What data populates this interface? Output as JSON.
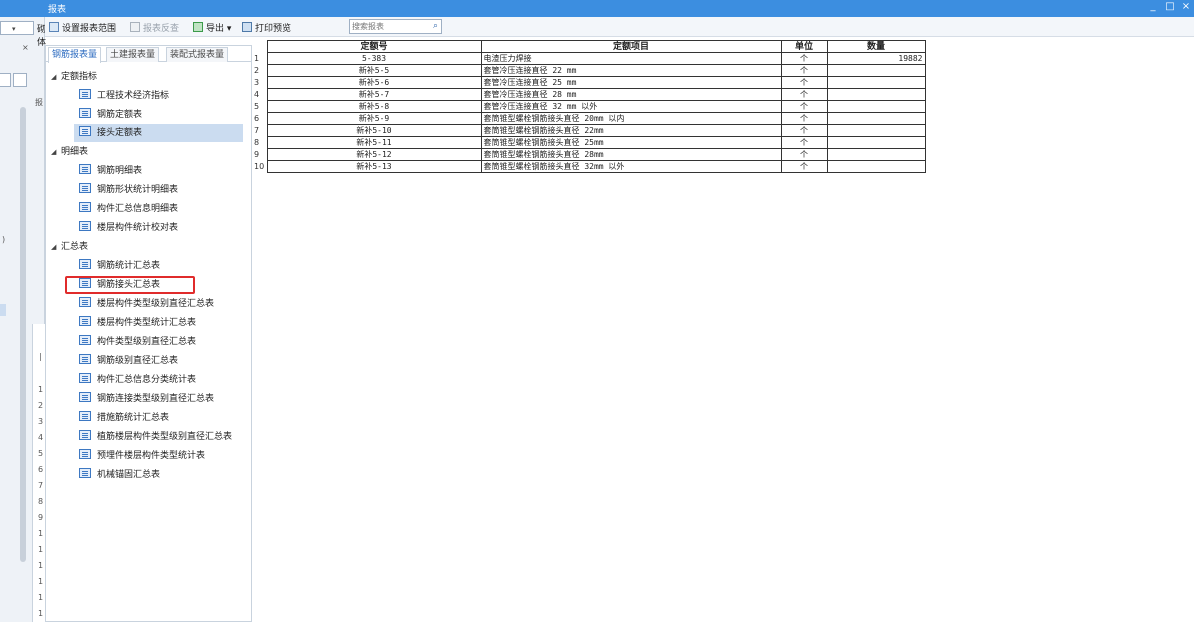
{
  "window": {
    "title": "报表",
    "controls": [
      "_",
      "□",
      "×"
    ]
  },
  "left_strip": {
    "combo_value": "",
    "combo_label": "砌体",
    "close_glyph": "×",
    "small_labels": [
      "报",
      ")",
      "|"
    ],
    "row_numbers": [
      "1",
      "2",
      "3",
      "4",
      "5",
      "6",
      "7",
      "8",
      "9",
      "1",
      "1",
      "1",
      "1",
      "1",
      "1",
      "1"
    ]
  },
  "toolbar": {
    "set_range": "设置报表范围",
    "report_query": "报表反查",
    "export": "导出",
    "export_caret": "▾",
    "print_preview": "打印预览",
    "search_placeholder": "搜索报表",
    "search_icon": "🔍"
  },
  "tree": {
    "tabs": [
      "钢筋报表量",
      "土建报表量",
      "装配式报表量"
    ],
    "active_tab": 0,
    "groups": [
      {
        "label": "定额指标",
        "items": [
          "工程技术经济指标",
          "钢筋定额表",
          "接头定额表"
        ]
      },
      {
        "label": "明细表",
        "items": [
          "钢筋明细表",
          "钢筋形状统计明细表",
          "构件汇总信息明细表",
          "楼层构件统计校对表"
        ]
      },
      {
        "label": "汇总表",
        "items": [
          "钢筋统计汇总表",
          "钢筋接头汇总表",
          "楼层构件类型级别直径汇总表",
          "楼层构件类型统计汇总表",
          "构件类型级别直径汇总表",
          "钢筋级别直径汇总表",
          "构件汇总信息分类统计表",
          "钢筋连接类型级别直径汇总表",
          "措施筋统计汇总表",
          "植筋楼层构件类型级别直径汇总表",
          "预埋件楼层构件类型统计表",
          "机械锚固汇总表"
        ]
      }
    ],
    "selected_item": "接头定额表",
    "highlighted_item": "钢筋接头汇总表"
  },
  "report": {
    "columns": [
      "定额号",
      "定额项目",
      "单位",
      "数量"
    ],
    "rows": [
      {
        "no": "1",
        "code": "5-383",
        "item": "电渣压力焊接",
        "unit": "个",
        "qty": "19882"
      },
      {
        "no": "2",
        "code": "新补5-5",
        "item": "套管冷压连接直径 22 mm",
        "unit": "个",
        "qty": ""
      },
      {
        "no": "3",
        "code": "新补5-6",
        "item": "套管冷压连接直径 25 mm",
        "unit": "个",
        "qty": ""
      },
      {
        "no": "4",
        "code": "新补5-7",
        "item": "套管冷压连接直径 28 mm",
        "unit": "个",
        "qty": ""
      },
      {
        "no": "5",
        "code": "新补5-8",
        "item": "套管冷压连接直径 32 mm 以外",
        "unit": "个",
        "qty": ""
      },
      {
        "no": "6",
        "code": "新补5-9",
        "item": "套筒锥型螺栓钢筋接头直径 20mm 以内",
        "unit": "个",
        "qty": ""
      },
      {
        "no": "7",
        "code": "新补5-10",
        "item": "套筒锥型螺栓钢筋接头直径 22mm",
        "unit": "个",
        "qty": ""
      },
      {
        "no": "8",
        "code": "新补5-11",
        "item": "套筒锥型螺栓钢筋接头直径 25mm",
        "unit": "个",
        "qty": ""
      },
      {
        "no": "9",
        "code": "新补5-12",
        "item": "套筒锥型螺栓钢筋接头直径 28mm",
        "unit": "个",
        "qty": ""
      },
      {
        "no": "10",
        "code": "新补5-13",
        "item": "套筒锥型螺栓钢筋接头直径 32mm 以外",
        "unit": "个",
        "qty": ""
      }
    ]
  },
  "colors": {
    "titlebar": "#3c8ee0",
    "selected_row": "#cbdcf0",
    "highlight_border": "#e02b2b",
    "active_tab_text": "#2c6bc0"
  }
}
